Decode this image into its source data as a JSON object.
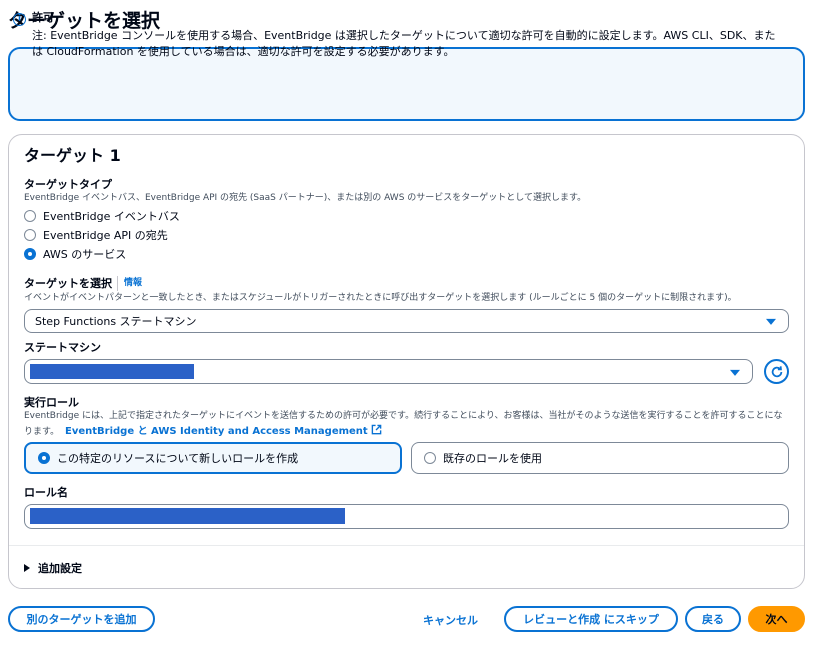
{
  "page": {
    "title": "ターゲットを選択"
  },
  "info": {
    "title": "許可",
    "body": "注: EventBridge コンソールを使用する場合、EventBridge は選択したターゲットについて適切な許可を自動的に設定します。AWS CLI、SDK、または CloudFormation を使用している場合は、適切な許可を設定する必要があります。"
  },
  "target": {
    "heading": "ターゲット 1",
    "type_label": "ターゲットタイプ",
    "type_desc": "EventBridge イベントバス、EventBridge API の宛先 (SaaS パートナー)、または別の AWS のサービスをターゲットとして選択します。",
    "type_options": [
      {
        "label": "EventBridge イベントバス",
        "selected": false
      },
      {
        "label": "EventBridge API の宛先",
        "selected": false
      },
      {
        "label": "AWS のサービス",
        "selected": true
      }
    ],
    "select_label": "ターゲットを選択",
    "select_info": "情報",
    "select_desc": "イベントがイベントパターンと一致したとき、またはスケジュールがトリガーされたときに呼び出すターゲットを選択します (ルールごとに 5 個のターゲットに制限されます)。",
    "select_value": "Step Functions ステートマシン",
    "state_machine_label": "ステートマシン",
    "role_label": "実行ロール",
    "role_desc": "EventBridge には、上記で指定されたターゲットにイベントを送信するための許可が必要です。続行することにより、お客様は、当社がそのような送信を実行することを許可することになります。",
    "role_link": "EventBridge と AWS Identity and Access Management",
    "role_options": [
      {
        "label": "この特定のリソースについて新しいロールを作成",
        "selected": true
      },
      {
        "label": "既存のロールを使用",
        "selected": false
      }
    ],
    "role_name_label": "ロール名",
    "additional_settings": "追加設定"
  },
  "footer": {
    "add_target": "別のターゲットを追加",
    "cancel": "キャンセル",
    "skip_review": "レビューと作成 にスキップ",
    "back": "戻る",
    "next": "次へ"
  },
  "colors": {
    "accent": "#0972d3",
    "primary": "#ff9900",
    "info_bg": "#f2f8fd",
    "redaction": "#2b61c7"
  }
}
